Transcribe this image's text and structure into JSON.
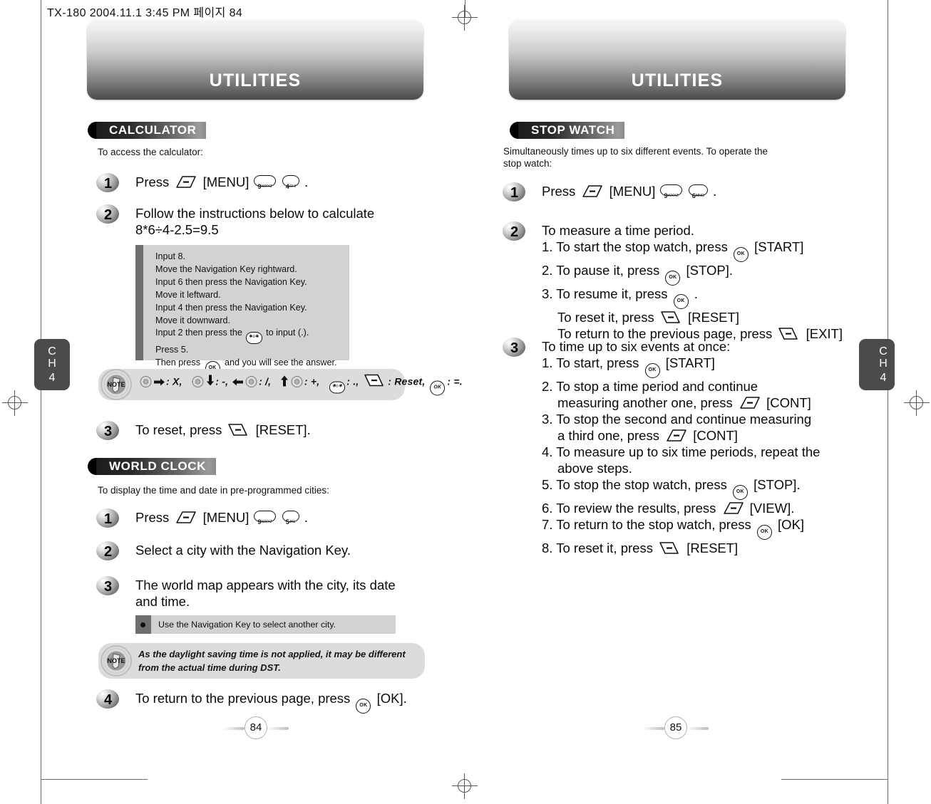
{
  "print_slug": "TX-180  2004.11.1 3:45 PM  페이지 84",
  "chapter_tab": {
    "ch_line1": "C",
    "ch_line2": "H",
    "number": "4"
  },
  "pages": {
    "left": {
      "banner_title": "UTILITIES",
      "folio": "84",
      "sections": [
        {
          "heading": "CALCULATOR",
          "lead": "To access the calculator:",
          "steps": [
            {
              "num": "1",
              "text_before": "Press",
              "keys": "softkey-left [MENU] 9wxyz 4ghi",
              "text_after": "."
            },
            {
              "num": "2",
              "line1": "Follow the instructions below to calculate",
              "line2": "8*6÷4-2.5=9.5"
            },
            {
              "num": "3",
              "text_before": "To reset, press",
              "keys": "softkey-right",
              "text_after": "[RESET]."
            }
          ],
          "panel_lines": [
            "Input 8.",
            "Move the Navigation Key rightward.",
            "Input 6 then press the Navigation Key.",
            "Move it leftward.",
            "Input 4 then press the Navigation Key.",
            "Move it downward.",
            "Input 2 then press the {STAR} to input (.).",
            "Press 5.",
            "Then press {OK} and you will see the answer."
          ],
          "note_symbols": {
            "badge": "NOTE",
            "items": [
              {
                "key": "nav-right",
                "label": ": X,"
              },
              {
                "key": "nav-down",
                "label": ": -,"
              },
              {
                "key": "nav-left",
                "label": ": /,"
              },
              {
                "key": "nav-up",
                "label": ": +,"
              },
              {
                "key": "star",
                "label": ": .,"
              },
              {
                "key": "softkey-right",
                "label": ": Reset,"
              },
              {
                "key": "ok",
                "label": ": =."
              }
            ]
          }
        },
        {
          "heading": "WORLD CLOCK",
          "lead": "To display the time and date in pre-programmed cities:",
          "steps": [
            {
              "num": "1",
              "text_before": "Press",
              "keys": "softkey-left [MENU] 9wxyz 5jkl",
              "text_after": "."
            },
            {
              "num": "2",
              "line1": "Select a city with the Navigation Key."
            },
            {
              "num": "3",
              "line1": "The world map appears with the city, its date",
              "line2": "and time."
            },
            {
              "num": "4",
              "text_before": "To return to the previous page, press",
              "keys": "ok",
              "text_after": "[OK]."
            }
          ],
          "tip": "Use the Navigation Key to select another city.",
          "note_text": "As the daylight saving time is not applied, it may be different from the actual time during DST."
        }
      ]
    },
    "right": {
      "banner_title": "UTILITIES",
      "folio": "85",
      "sections": [
        {
          "heading": "STOP WATCH",
          "lead_line1": "Simultaneously times up to six different events. To operate the",
          "lead_line2": "stop watch:",
          "steps": [
            {
              "num": "1",
              "text_before": "Press",
              "keys": "softkey-left [MENU] 9wxyz 6mno",
              "text_after": "."
            },
            {
              "num": "2",
              "line1": "To measure a time period.",
              "sublines": [
                "1. To start the stop watch, press {OK} [START].",
                "2. To pause it, press {OK} [STOP].",
                "3. To resume it, press {OK} .",
                "To reset it, press {SOFTR} [RESET].",
                "To return to the previous page, press {SOFTR} [EXIT]."
              ]
            },
            {
              "num": "3",
              "line1": "To time up to six events at once:",
              "sublines": [
                "1. To start, press {OK} [START].",
                "2. To stop a time period and continue",
                "measuring another one, press {SOFTL} [CONT].",
                "3. To stop the second and continue measuring",
                "a third one, press {SOFTL} [CONT].",
                "4. To measure up to six time periods, repeat the",
                "above steps.",
                "5. To stop the stop watch, press {OK} [STOP].",
                "6. To review the results, press {SOFTL} [VIEW].",
                "7. To return to the stop watch, press {OK} [OK].",
                "8. To reset it, press {SOFTR} [RESET]."
              ]
            }
          ]
        }
      ]
    }
  },
  "labels": {
    "menu": "[MENU]",
    "reset": "[RESET]",
    "ok": "[OK]",
    "start": "[START]",
    "stop": "[STOP]",
    "exit": "[EXIT]",
    "cont": "[CONT]",
    "view": "[VIEW]",
    "key9": "9",
    "key9sub": "WXYZ",
    "key4": "4",
    "key4sub": "GHI",
    "key5": "5",
    "key5sub": "JKL",
    "key6": "6",
    "key6sub": "MNO",
    "okkey": "OK",
    "starkey": "✱o✱"
  },
  "colors": {
    "banner_dark": "#4a4a4a",
    "panel_gray": "#d2d2d2",
    "spine_gray": "#6e6e6e",
    "note_gray": "#dcdcdc",
    "tab_gray": "#4b4b4b"
  }
}
